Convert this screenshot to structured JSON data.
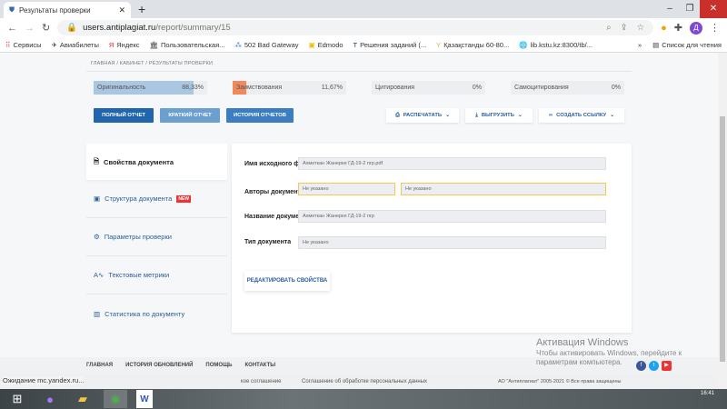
{
  "browser": {
    "tab_title": "Результаты проверки",
    "url_host": "users.antiplagiat.ru",
    "url_path": "/report/summary/15",
    "avatar": "Д",
    "bookmarks": [
      "Сервисы",
      "Авиабилеты",
      "Яндекс",
      "Пользовательская...",
      "502 Bad Gateway",
      "Edmodo",
      "Решения заданий (...",
      "Қазақстанды 60-80...",
      "lib.kstu.kz:8300/tb/..."
    ],
    "reading_list": "Список для чтения"
  },
  "breadcrumb": "ГЛАВНАЯ / КАБИНЕТ / РЕЗУЛЬТАТЫ ПРОВЕРКИ",
  "stats": [
    {
      "label": "Оригинальность",
      "value": "88,33%",
      "fraction": 0.8833,
      "color": "#a9c7e0"
    },
    {
      "label": "Заимствования",
      "value": "11,67%",
      "fraction": 0.1167,
      "color": "#f08a5d"
    },
    {
      "label": "Цитирования",
      "value": "0%",
      "fraction": 0
    },
    {
      "label": "Самоцитирования",
      "value": "0%",
      "fraction": 0
    }
  ],
  "actions": {
    "full": "ПОЛНЫЙ ОТЧЕТ",
    "short": "КРАТКИЙ ОТЧЕТ",
    "history": "ИСТОРИЯ ОТЧЕТОВ",
    "print": "РАСПЕЧАТАТЬ",
    "export": "ВЫГРУЗИТЬ",
    "link": "СОЗДАТЬ ССЫЛКУ"
  },
  "sidebar": [
    {
      "label": "Свойства документа"
    },
    {
      "label": "Структура документа",
      "badge": "NEW"
    },
    {
      "label": "Параметры проверки"
    },
    {
      "label": "Текстовые метрики"
    },
    {
      "label": "Статистика по документу"
    }
  ],
  "props": {
    "file_label": "Имя исходного файла",
    "file": "Ахметкан Жанерке ГД-19-2 пгр.pdf",
    "authors_label": "Авторы документа",
    "author1": "Не указано",
    "author2": "Не указано",
    "title_label": "Название документа",
    "title": "Ахметкан Жанерке ГД-19-2 пгр",
    "type_label": "Тип документа",
    "type": "Не указано",
    "edit": "РЕДАКТИРОВАТЬ СВОЙСТВА"
  },
  "footer": [
    "ГЛАВНАЯ",
    "ИСТОРИЯ ОБНОВЛЕНИЙ",
    "ПОМОЩЬ",
    "КОНТАКТЫ"
  ],
  "status": {
    "loading": "Ожидание mc.yandex.ru...",
    "agreement": "кое соглашение",
    "personal": "Соглашение об обработке персональных данных",
    "copyright": "АО \"Антиплагиат\" 2005-2021 © Все права защищены"
  },
  "activation": {
    "title": "Активация Windows",
    "line1": "Чтобы активировать Windows, перейдите к",
    "line2": "параметрам компьютера."
  },
  "clock": "16:41"
}
